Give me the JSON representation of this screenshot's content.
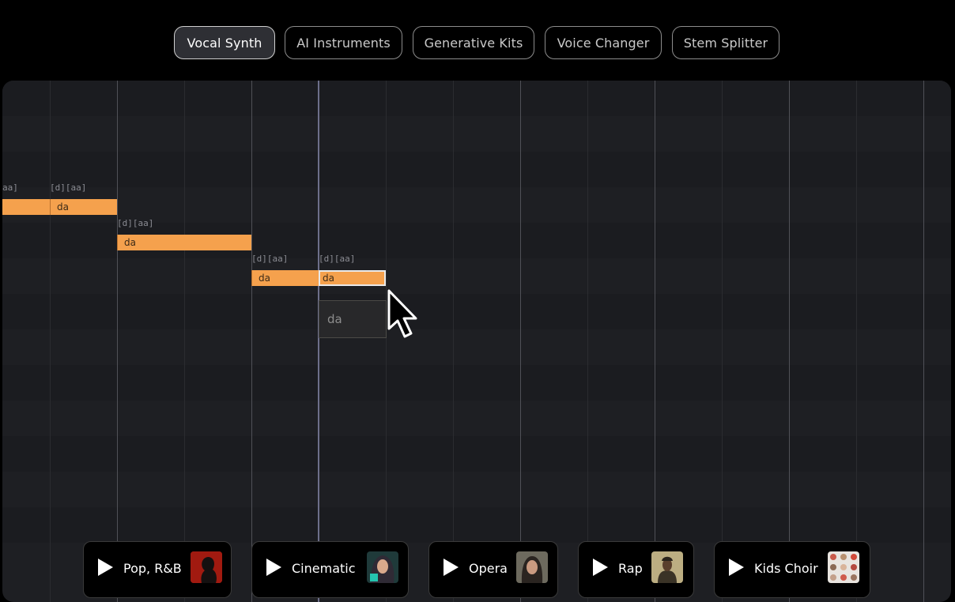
{
  "tabs": [
    {
      "label": "Vocal Synth",
      "active": true
    },
    {
      "label": "AI Instruments",
      "active": false
    },
    {
      "label": "Generative Kits",
      "active": false
    },
    {
      "label": "Voice Changer",
      "active": false
    },
    {
      "label": "Stem Splitter",
      "active": false
    }
  ],
  "notes": [
    {
      "phoneme": "aa]",
      "lyric": ""
    },
    {
      "phoneme": "[d][aa]",
      "lyric": "da"
    },
    {
      "phoneme": "[d][aa]",
      "lyric": "da"
    },
    {
      "phoneme": "[d][aa]",
      "lyric": "da"
    },
    {
      "phoneme": "[d][aa]",
      "lyric": "da"
    }
  ],
  "ghost_note": {
    "lyric": "da"
  },
  "presets": [
    {
      "label": "Pop, R&B",
      "thumb": "singer-silhouette-red"
    },
    {
      "label": "Cinematic",
      "thumb": "singer-teal-hair"
    },
    {
      "label": "Opera",
      "thumb": "singer-portrait"
    },
    {
      "label": "Rap",
      "thumb": "rapper-portrait"
    },
    {
      "label": "Kids Choir",
      "thumb": "kids-grid"
    }
  ],
  "colors": {
    "note": "#f5a14d",
    "active_tab_bg": "#2e2f34",
    "roll_bg": "#1e1f23"
  }
}
